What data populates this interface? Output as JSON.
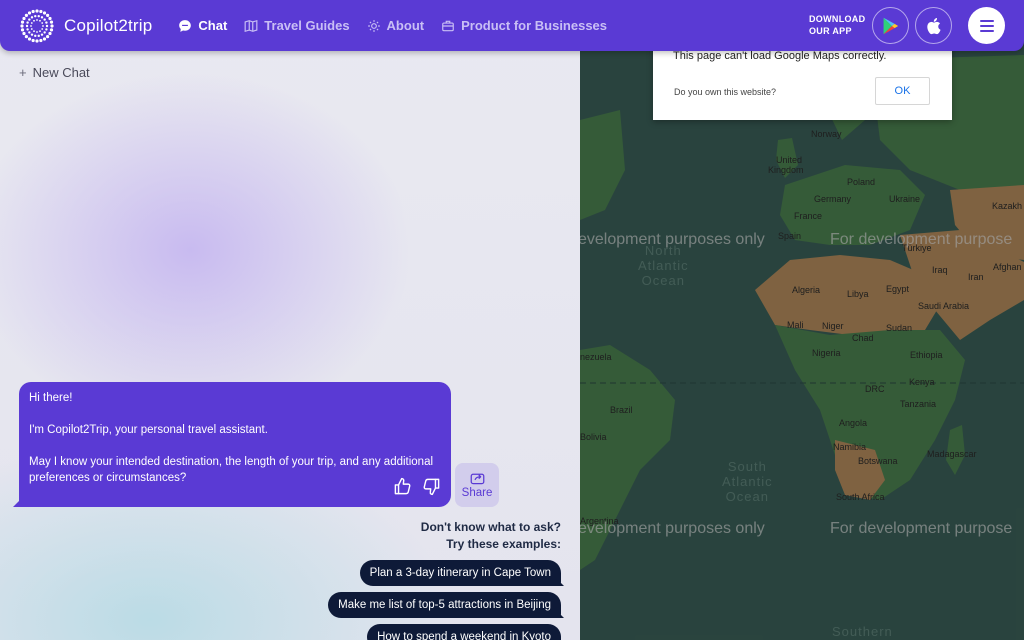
{
  "header": {
    "logo_text": "Copilot2trip",
    "nav": [
      {
        "label": "Chat",
        "icon": "chat-bubble-icon",
        "active": true
      },
      {
        "label": "Travel Guides",
        "icon": "map-icon",
        "active": false
      },
      {
        "label": "About",
        "icon": "sun-icon",
        "active": false
      },
      {
        "label": "Product for Businesses",
        "icon": "briefcase-icon",
        "active": false
      }
    ],
    "download_line1": "DOWNLOAD",
    "download_line2": "OUR APP"
  },
  "chat": {
    "new_chat_label": "New Chat",
    "assistant_message": {
      "greeting": "Hi there!",
      "intro": "I'm Copilot2Trip, your personal travel assistant.",
      "question": "May I know your intended destination, the length of your trip, and any additional preferences or circumstances?"
    },
    "share_label": "Share",
    "suggestions_title_line1": "Don't know what to ask?",
    "suggestions_title_line2": "Try these examples:",
    "suggestions": [
      "Plan a 3-day itinerary in Cape Town",
      "Make me list of top-5 attractions in Beijing",
      "How to spend a weekend in Kyoto"
    ]
  },
  "map": {
    "dialog_message": "This page can't load Google Maps correctly.",
    "dialog_question": "Do you own this website?",
    "dialog_ok": "OK",
    "watermark": "For development purposes only",
    "watermark_cut": "evelopment purposes only",
    "watermark_right": "For development purpose",
    "oceans": [
      {
        "line1": "North",
        "line2": "Atlantic",
        "line3": "Ocean"
      },
      {
        "line1": "South",
        "line2": "Atlantic",
        "line3": "Ocean"
      },
      {
        "line1": "Southern",
        "line2": "",
        "line3": ""
      }
    ],
    "labels": {
      "norway": "Norway",
      "uk": "United",
      "uk2": "Kingdom",
      "poland": "Poland",
      "germany": "Germany",
      "ukraine": "Ukraine",
      "france": "France",
      "spain": "Spain",
      "turkey": "Türkiye",
      "kazakh": "Kazakh",
      "iraq": "Iraq",
      "iran": "Iran",
      "afghan": "Afghan",
      "algeria": "Algeria",
      "libya": "Libya",
      "egypt": "Egypt",
      "saudi": "Saudi Arabia",
      "mali": "Mali",
      "niger": "Niger",
      "sudan": "Sudan",
      "chad": "Chad",
      "nigeria": "Nigeria",
      "ethiopia": "Ethiopia",
      "venezuela": "nezuela",
      "drc": "DRC",
      "kenya": "Kenya",
      "tanzania": "Tanzania",
      "brazil": "Brazil",
      "bolivia": "Bolivia",
      "angola": "Angola",
      "namibia": "Namibia",
      "botswana": "Botswana",
      "madagascar": "Madagascar",
      "south_africa": "South Africa",
      "argentina": "Argentina"
    }
  },
  "colors": {
    "brand": "#5a3ad4",
    "chip": "#0e1a38",
    "map_ocean": "#3a5e56",
    "map_land_green": "#4a7f4e",
    "map_land_desert": "#b0885a"
  }
}
